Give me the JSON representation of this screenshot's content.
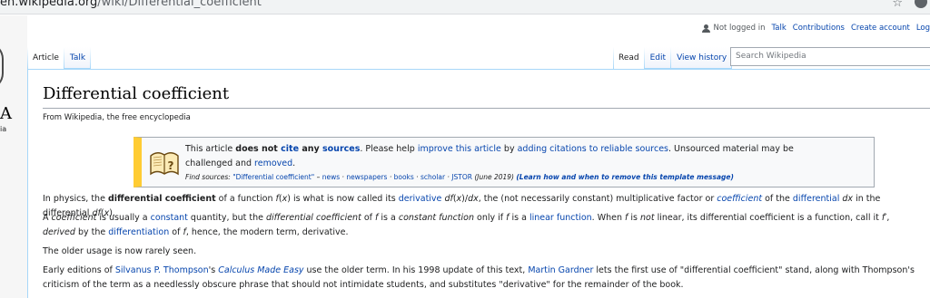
{
  "browser": {
    "url_domain": "en.wikipedia.org",
    "url_path": "/wiki/Differential_coefficient"
  },
  "sidebar": {
    "logo_letter": "A",
    "logo_sub": "ia"
  },
  "personal_tools": {
    "not_logged_in": "Not logged in",
    "talk": "Talk",
    "contributions": "Contributions",
    "create_account": "Create account",
    "login": "Log"
  },
  "tabs": {
    "article": "Article",
    "talk": "Talk",
    "read": "Read",
    "edit": "Edit",
    "view_history": "View history"
  },
  "search": {
    "placeholder": "Search Wikipedia"
  },
  "article": {
    "title": "Differential coefficient",
    "tagline": "From Wikipedia, the free encyclopedia"
  },
  "ambox": {
    "t1": "This article ",
    "t2": "does not ",
    "cite": "cite",
    "t3": " any ",
    "sources": "sources",
    "t4": ". Please help ",
    "improve": "improve this article",
    "t5": " by ",
    "adding": "adding citations to reliable sources",
    "t6": ". Unsourced material may be challenged and ",
    "removed": "removed",
    "t7": ".",
    "find_label": "Find sources: ",
    "find_query": "\"Differential coefficient\"",
    "find_sep0": " – ",
    "news": "news",
    "sep": " · ",
    "newspapers": "newspapers",
    "books": "books",
    "scholar": "scholar",
    "jstor": "JSTOR",
    "date": " (June 2019) ",
    "learn": "(Learn how and when to remove this template message)"
  },
  "p1": {
    "a": "In physics, the ",
    "b": "differential coefficient",
    "c": " of a function ",
    "d": "f",
    "e": "(",
    "f": "x",
    "g": ") is what is now called its ",
    "h": "derivative",
    "i": " ",
    "j": "df",
    "k": "(",
    "l": "x",
    "m": ")/",
    "n": "dx",
    "o": ", the (not necessarily constant) multiplicative factor or ",
    "p": "coefficient",
    "q": " of the ",
    "r": "differential",
    "s": " ",
    "t": "dx",
    "u": " in the differential ",
    "v": "df",
    "w": "(",
    "x": "x",
    "y": ")."
  },
  "p2": {
    "a": "A ",
    "b": "coefficient",
    "c": " is usually a ",
    "d": "constant",
    "e": " quantity, but the ",
    "f": "differential coefficient",
    "g": " of ",
    "h": "f",
    "i": " is a ",
    "j": "constant function",
    "k": " only if ",
    "l": "f",
    "m": " is a ",
    "n": "linear function",
    "o": ". When ",
    "p": "f",
    "q": " is ",
    "r": "not",
    "s": " linear, its differential coefficient is a function, call it ",
    "t": "f′",
    "u": ", ",
    "v": "derived",
    "w": " by the ",
    "x": "differentiation",
    "y": " of ",
    "z": "f",
    "z2": ", hence, the modern term, derivative."
  },
  "p3": {
    "a": "The older usage is now rarely seen."
  },
  "p4": {
    "a": "Early editions of ",
    "b": "Silvanus P. Thompson",
    "c": "'s ",
    "d": "Calculus Made Easy",
    "e": " use the older term. In his 1998 update of this text, ",
    "f": "Martin Gardner",
    "g": " lets the first use of \"differential coefficient\" stand, along with Thompson's criticism of the term as a needlessly obscure phrase that should not intimidate students, and substitutes \"derivative\" for the remainder of the book."
  },
  "colors": {
    "link": "#0645ad",
    "ambox_accent": "#ffcc33",
    "tab_border": "#a7d7f9"
  }
}
